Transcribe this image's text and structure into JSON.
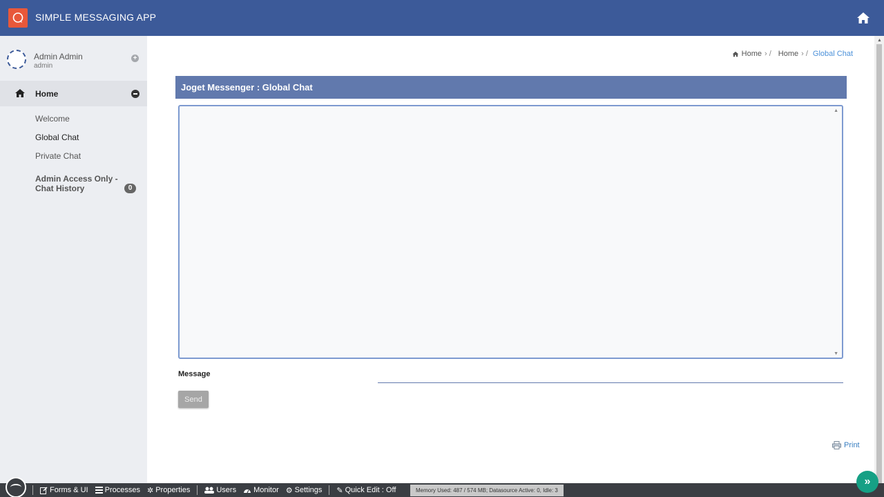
{
  "header": {
    "app_title": "SIMPLE MESSAGING APP",
    "logo_icon": "chat-bubble-icon",
    "home_icon": "home-icon",
    "background_color": "#3c5a99",
    "logo_color": "#e8583a"
  },
  "sidebar": {
    "user": {
      "name": "Admin Admin",
      "login": "admin"
    },
    "home": {
      "label": "Home"
    },
    "items": [
      {
        "label": "Welcome"
      },
      {
        "label": "Global Chat"
      },
      {
        "label": "Private Chat"
      },
      {
        "label": "Admin Access Only - Chat History",
        "badge": "0"
      }
    ]
  },
  "breadcrumb": {
    "items": [
      "Home",
      "Home",
      "Global Chat"
    ]
  },
  "main": {
    "panel_title": "Joget Messenger : Global Chat",
    "message_label": "Message",
    "message_value": "",
    "send_label": "Send",
    "print_label": "Print"
  },
  "adminbar": {
    "items": [
      {
        "label": "Forms & UI",
        "icon": "edit-icon"
      },
      {
        "label": "Processes",
        "icon": "list-icon"
      },
      {
        "label": "Properties",
        "icon": "gear-icon"
      },
      {
        "label": "Users",
        "icon": "users-icon"
      },
      {
        "label": "Monitor",
        "icon": "dashboard-icon"
      },
      {
        "label": "Settings",
        "icon": "gears-icon"
      },
      {
        "label": "Quick Edit : Off",
        "icon": "pencil-icon"
      }
    ],
    "memory_text": "Memory Used: 487 / 574 MB; Datasource Active: 0, Idle: 3",
    "accent_color": "#16a085"
  }
}
